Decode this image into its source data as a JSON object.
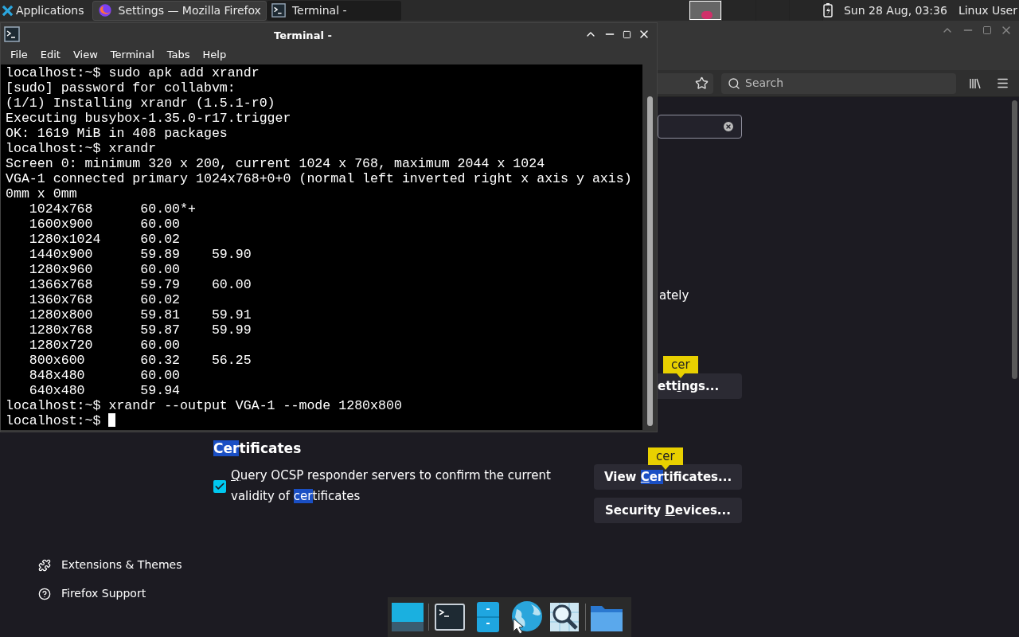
{
  "panel": {
    "menu_label": "Applications",
    "tasks": [
      {
        "title": "Settings — Mozilla Firefox",
        "kind": "browser",
        "selected": false
      },
      {
        "title": "Terminal -",
        "kind": "terminal",
        "selected": true
      }
    ],
    "workspaces": [
      {
        "selected": true
      },
      {
        "selected": false
      },
      {
        "selected": false
      },
      {
        "selected": false
      }
    ],
    "clock": "Sun 28 Aug, 03:36",
    "user": "Linux User"
  },
  "terminal": {
    "title": "Terminal -",
    "menu": [
      "File",
      "Edit",
      "View",
      "Terminal",
      "Tabs",
      "Help"
    ],
    "lines": [
      "localhost:~$ sudo apk add xrandr",
      "[sudo] password for collabvm:",
      "(1/1) Installing xrandr (1.5.1-r0)",
      "Executing busybox-1.35.0-r17.trigger",
      "OK: 1619 MiB in 408 packages",
      "localhost:~$ xrandr",
      "Screen 0: minimum 320 x 200, current 1024 x 768, maximum 2044 x 1024",
      "VGA-1 connected primary 1024x768+0+0 (normal left inverted right x axis y axis)",
      "0mm x 0mm",
      "   1024x768      60.00*+",
      "   1600x900      60.00",
      "   1280x1024     60.02",
      "   1440x900      59.89    59.90",
      "   1280x960      60.00",
      "   1366x768      59.79    60.00",
      "   1360x768      60.02",
      "   1280x800      59.81    59.91",
      "   1280x768      59.87    59.99",
      "   1280x720      60.00",
      "   800x600       60.32    56.25",
      "   848x480       60.00",
      "   640x480       59.94",
      "localhost:~$ xrandr --output VGA-1 --mode 1280x800",
      "localhost:~$"
    ]
  },
  "browser": {
    "search_placeholder": "Search",
    "partial_text": "ately",
    "settings_button": {
      "label": [
        {
          "text": "ett",
          "kind": "plain"
        },
        {
          "text": "i",
          "kind": "key"
        },
        {
          "text": "ngs...",
          "kind": "plain"
        }
      ],
      "tooltip": "cer"
    },
    "certificates": {
      "heading": [
        {
          "text": "Cer",
          "kind": "match"
        },
        {
          "text": "tificates",
          "kind": "plain"
        }
      ],
      "checkbox": {
        "checked": true,
        "label": [
          {
            "text": "Q",
            "kind": "key"
          },
          {
            "text": "uery OCSP responder servers to confirm the current validity of ",
            "kind": "plain"
          },
          {
            "text": "cer",
            "kind": "match"
          },
          {
            "text": "tificates",
            "kind": "plain"
          }
        ]
      },
      "buttons": [
        {
          "label": [
            {
              "text": "View ",
              "kind": "plain"
            },
            {
              "text": "C",
              "kind": "matchkey"
            },
            {
              "text": "er",
              "kind": "match"
            },
            {
              "text": "tificates...",
              "kind": "plain"
            }
          ],
          "tooltip": "cer"
        },
        {
          "label": [
            {
              "text": "Security ",
              "kind": "plain"
            },
            {
              "text": "D",
              "kind": "key"
            },
            {
              "text": "evices...",
              "kind": "plain"
            }
          ]
        }
      ]
    },
    "sidebar": [
      {
        "label": "Extensions & Themes",
        "kind": "extensions"
      },
      {
        "label": "Firefox Support",
        "kind": "support"
      }
    ]
  },
  "dock": [
    {
      "kind": "desktop"
    },
    {
      "kind": "terminal"
    },
    {
      "kind": "cabinet"
    },
    {
      "kind": "globe"
    },
    {
      "kind": "magnifier"
    },
    {
      "kind": "folder"
    }
  ]
}
